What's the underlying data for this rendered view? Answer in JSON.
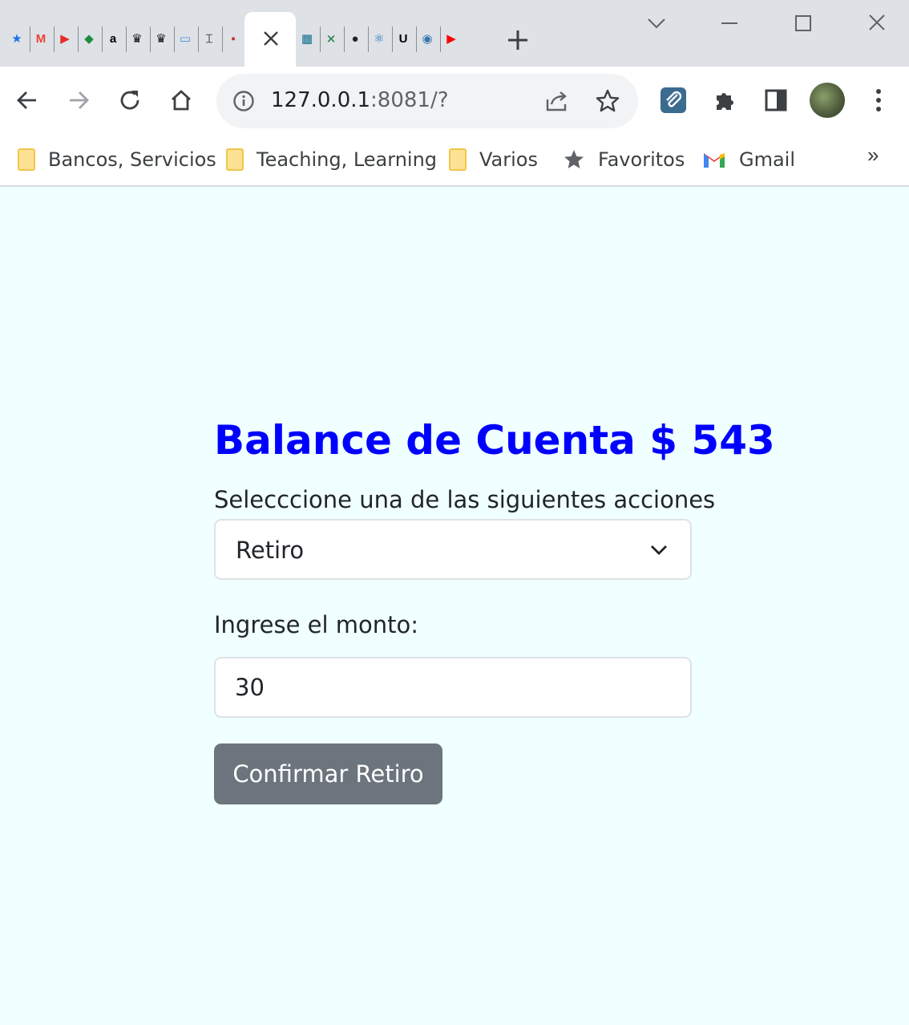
{
  "browser": {
    "tab_favicons": [
      {
        "name": "star-favicon",
        "glyph": "★",
        "color": "#1a73e8"
      },
      {
        "name": "gmail-favicon",
        "glyph": "M",
        "color": "#ea4335"
      },
      {
        "name": "youtube-red-favicon",
        "glyph": "▶",
        "color": "#e52d27"
      },
      {
        "name": "green-leaf-favicon",
        "glyph": "◆",
        "color": "#1e8e3e"
      },
      {
        "name": "amazon-favicon",
        "glyph": "a",
        "color": "#000000"
      },
      {
        "name": "crown-favicon",
        "glyph": "♛",
        "color": "#111111"
      },
      {
        "name": "crown-favicon",
        "glyph": "♛",
        "color": "#111111"
      },
      {
        "name": "monitor-favicon",
        "glyph": "▭",
        "color": "#4a90d9"
      },
      {
        "name": "pillar-favicon",
        "glyph": "⌶",
        "color": "#555555"
      },
      {
        "name": "small-favicon",
        "glyph": "▪",
        "color": "#c0392b"
      },
      {
        "name": "circuit-favicon",
        "glyph": "▦",
        "color": "#0b6e8a"
      },
      {
        "name": "green-arrows-favicon",
        "glyph": "⨯",
        "color": "#2e8b57"
      },
      {
        "name": "github-favicon",
        "glyph": "●",
        "color": "#222222"
      },
      {
        "name": "atom-favicon",
        "glyph": "⚛",
        "color": "#1f78b4"
      },
      {
        "name": "u-favicon",
        "glyph": "U",
        "color": "#000000"
      },
      {
        "name": "python-favicon",
        "glyph": "◉",
        "color": "#3776ab"
      },
      {
        "name": "youtube-favicon",
        "glyph": "▶",
        "color": "#ff0000"
      }
    ],
    "url_host": "127.0.0.1",
    "url_rest": ":8081/?",
    "bookmarks": [
      {
        "label": "Bancos, Servicios",
        "icon": "folder-icon"
      },
      {
        "label": "Teaching, Learning",
        "icon": "folder-icon"
      },
      {
        "label": "Varios",
        "icon": "folder-icon"
      },
      {
        "label": "Favoritos",
        "icon": "star-icon"
      },
      {
        "label": "Gmail",
        "icon": "gmail-icon"
      }
    ],
    "bookmarks_overflow": "»"
  },
  "page": {
    "title": "Balance de Cuenta $ 543",
    "action_label": "Selecccione una de las siguientes acciones",
    "action_selected": "Retiro",
    "amount_label": "Ingrese el monto:",
    "amount_value": "30",
    "confirm_label": "Confirmar Retiro",
    "colors": {
      "background": "#f0ffff",
      "title": "#0000ff",
      "button": "#6c757d"
    }
  }
}
